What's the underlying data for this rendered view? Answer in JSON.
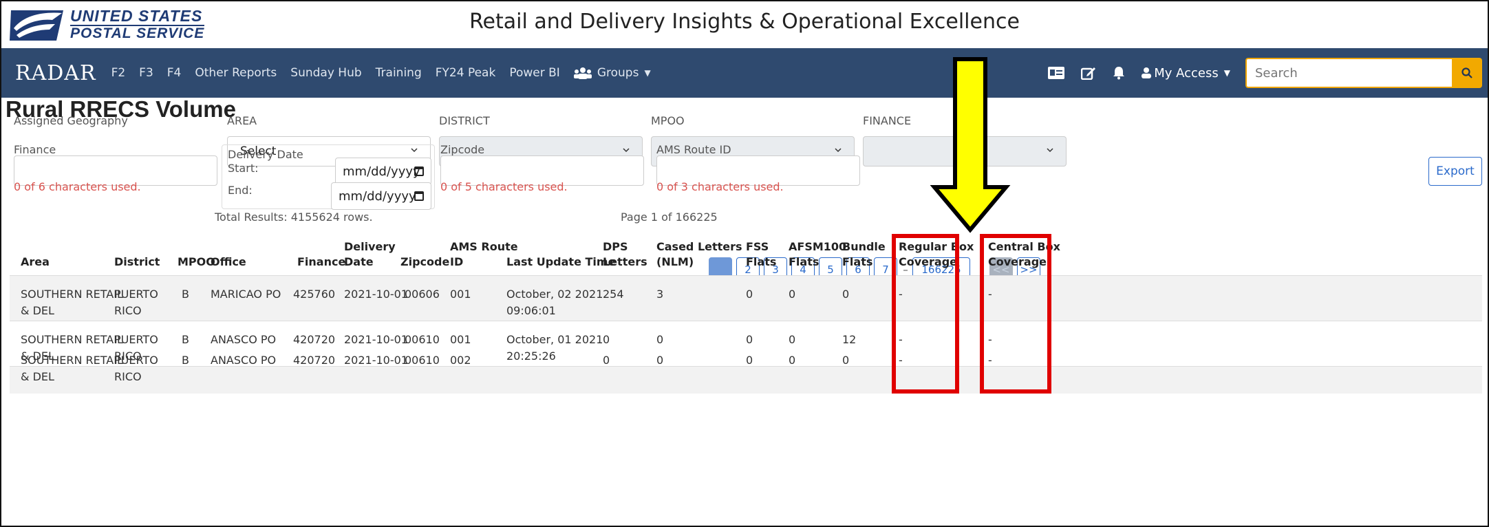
{
  "header": {
    "logo_line1": "UNITED STATES",
    "logo_line2": "POSTAL SERVICE",
    "title": "Retail and Delivery Insights & Operational Excellence"
  },
  "navbar": {
    "brand": "RADAR",
    "links": [
      "F2",
      "F3",
      "F4",
      "Other Reports",
      "Sunday Hub",
      "Training",
      "FY24 Peak",
      "Power BI"
    ],
    "groups_label": "Groups",
    "my_access_label": "My Access",
    "search_placeholder": "Search"
  },
  "page": {
    "title": "Rural RRECS Volume"
  },
  "filters": {
    "assigned_geography_label": "Assigned Geography",
    "area_label": "AREA",
    "area_value": "Select",
    "district_label": "DISTRICT",
    "mpoo_label": "MPOO",
    "finance_top_label": "FINANCE",
    "finance_label": "Finance",
    "finance_counter": "0 of 6 characters used.",
    "delivery_date_label": "Delivery Date",
    "start_label": "Start:",
    "end_label": "End:",
    "date_placeholder": "mm/dd/yyyy",
    "zipcode_label": "Zipcode",
    "zipcode_counter": "0 of 5 characters used.",
    "ams_route_label": "AMS Route ID",
    "ams_counter": "0 of 3 characters used.",
    "export_label": "Export"
  },
  "results": {
    "total": "Total Results: 4155624 rows.",
    "page_info": "Page 1 of 166225",
    "pages": [
      "1",
      "2",
      "3",
      "4",
      "5",
      "6",
      "7"
    ],
    "last_page": "166225",
    "prev_label": "<<",
    "next_label": ">>"
  },
  "table": {
    "headers": {
      "area": "Area",
      "district": "District",
      "mpoo": "MPOO",
      "office": "Office",
      "finance": "Finance",
      "delivery_date_1": "Delivery",
      "delivery_date_2": "Date",
      "zipcode": "Zipcode",
      "ams_1": "AMS Route",
      "ams_2": "ID",
      "last_update": "Last Update Time",
      "dps_1": "DPS",
      "dps_2": "Letters",
      "cased_1": "Cased Letters",
      "cased_2": "(NLM)",
      "fss_1": "FSS",
      "fss_2": "Flats",
      "afsm_1": "AFSM100",
      "afsm_2": "Flats",
      "bundle_1": "Bundle",
      "bundle_2": "Flats",
      "regular_1": "Regular Box",
      "regular_2": "Coverage",
      "central_1": "Central Box",
      "central_2": "Coverage"
    },
    "rows": [
      {
        "area1": "SOUTHERN RETAIL",
        "area2": "& DEL",
        "district1": "PUERTO",
        "district2": "RICO",
        "mpoo": "B",
        "office": "MARICAO PO",
        "finance": "425760",
        "date": "2021-10-01",
        "zip": "00606",
        "ams": "001",
        "update1": "October, 02 2021",
        "update2": "09:06:01",
        "dps": "254",
        "cased": "3",
        "fss": "0",
        "afsm": "0",
        "bundle": "0",
        "regular": "-",
        "central": "-"
      },
      {
        "area1": "SOUTHERN RETAIL",
        "area2": "& DEL",
        "district1": "PUERTO",
        "district2": "RICO",
        "mpoo": "B",
        "office": "ANASCO PO",
        "finance": "420720",
        "date": "2021-10-01",
        "zip": "00610",
        "ams": "001",
        "update1": "October, 01 2021",
        "update2": "20:25:26",
        "dps": "0",
        "cased": "0",
        "fss": "0",
        "afsm": "0",
        "bundle": "12",
        "regular": "-",
        "central": "-"
      },
      {
        "area1": "SOUTHERN RETAIL",
        "area2": "& DEL",
        "district1": "PUERTO",
        "district2": "RICO",
        "mpoo": "B",
        "office": "ANASCO PO",
        "finance": "420720",
        "date": "2021-10-01",
        "zip": "00610",
        "ams": "002",
        "update1": "",
        "update2": "",
        "dps": "0",
        "cased": "0",
        "fss": "0",
        "afsm": "0",
        "bundle": "0",
        "regular": "-",
        "central": "-"
      }
    ]
  },
  "colors": {
    "navbar": "#2f4a6f",
    "search_accent": "#f2a900",
    "link_blue": "#2a6acb",
    "error_red": "#d9534f",
    "annotation_red": "#e00000",
    "annotation_arrow": "#ffff00"
  }
}
